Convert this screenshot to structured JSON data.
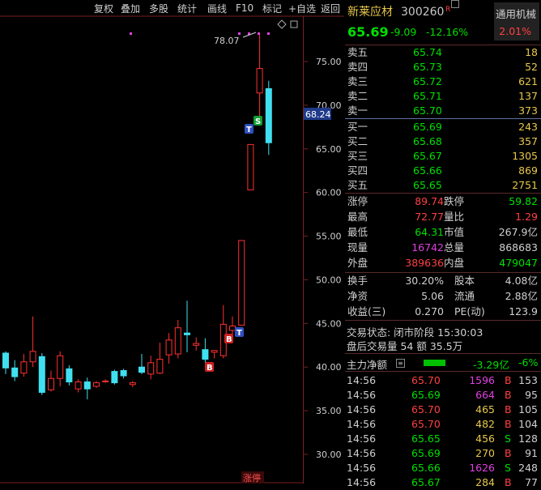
{
  "toolbar": {
    "items": [
      "复权",
      "叠加",
      "多股",
      "统计",
      "画线",
      "F10",
      "标记",
      "+自选",
      "返回"
    ]
  },
  "chart": {
    "y_ticks": [
      "75.00",
      "70.00",
      "65.00",
      "60.00",
      "55.00",
      "50.00",
      "45.00",
      "40.00",
      "35.00",
      "30.00"
    ],
    "current_price_tag": "68.24",
    "high_annotation": "78.07",
    "bottom_label": "涨停",
    "marker_b": "B",
    "marker_s": "S",
    "marker_t": "T"
  },
  "chart_data": {
    "type": "candlestick",
    "y_range": [
      27.5,
      80.0
    ],
    "candles": [
      {
        "o": 41.6,
        "c": 39.9,
        "h": 41.8,
        "l": 39.2
      },
      {
        "o": 39.9,
        "c": 38.9,
        "h": 40.8,
        "l": 38.4
      },
      {
        "o": 39.3,
        "c": 40.6,
        "h": 41.5,
        "l": 38.9
      },
      {
        "o": 40.6,
        "c": 41.8,
        "h": 45.8,
        "l": 40.0
      },
      {
        "o": 41.2,
        "c": 37.1,
        "h": 41.6,
        "l": 36.8
      },
      {
        "o": 37.4,
        "c": 38.7,
        "h": 39.6,
        "l": 37.2
      },
      {
        "o": 38.7,
        "c": 41.3,
        "h": 41.8,
        "l": 37.8
      },
      {
        "o": 39.8,
        "c": 38.3,
        "h": 40.2,
        "l": 37.9
      },
      {
        "o": 37.5,
        "c": 38.3,
        "h": 38.6,
        "l": 37.1
      },
      {
        "o": 38.3,
        "c": 37.5,
        "h": 38.8,
        "l": 36.3
      },
      {
        "o": 37.8,
        "c": 38.2,
        "h": 38.4,
        "l": 37.6
      },
      {
        "o": 38.4,
        "c": 38.4,
        "h": 38.6,
        "l": 38.2
      },
      {
        "o": 39.5,
        "c": 38.2,
        "h": 39.7,
        "l": 38.0
      },
      {
        "o": 39.6,
        "c": 39.0,
        "h": 39.8,
        "l": 38.7
      },
      {
        "o": 38.0,
        "c": 38.2,
        "h": 38.4,
        "l": 37.7
      },
      {
        "o": 40.0,
        "c": 39.4,
        "h": 41.5,
        "l": 39.2
      },
      {
        "o": 39.2,
        "c": 40.5,
        "h": 41.3,
        "l": 38.6
      },
      {
        "o": 39.3,
        "c": 40.9,
        "h": 42.8,
        "l": 39.2
      },
      {
        "o": 41.4,
        "c": 43.1,
        "h": 43.9,
        "l": 40.4
      },
      {
        "o": 41.5,
        "c": 44.5,
        "h": 45.4,
        "l": 41.0
      },
      {
        "o": 43.9,
        "c": 43.7,
        "h": 47.6,
        "l": 41.7
      },
      {
        "o": 42.5,
        "c": 42.7,
        "h": 43.4,
        "l": 41.9
      },
      {
        "o": 42.0,
        "c": 40.9,
        "h": 43.3,
        "l": 40.5
      },
      {
        "o": 41.7,
        "c": 41.9,
        "h": 41.9,
        "l": 41.0
      },
      {
        "o": 41.3,
        "c": 44.9,
        "h": 47.1,
        "l": 41.0
      },
      {
        "o": 44.2,
        "c": 44.7,
        "h": 45.8,
        "l": 43.7
      },
      {
        "o": 44.8,
        "c": 54.5,
        "h": 54.5,
        "l": 44.8
      },
      {
        "o": 60.3,
        "c": 65.5,
        "h": 65.5,
        "l": 60.3
      },
      {
        "o": 71.4,
        "c": 74.2,
        "h": 78.1,
        "l": 68.5
      },
      {
        "o": 71.9,
        "c": 65.7,
        "h": 72.8,
        "l": 64.3
      }
    ]
  },
  "stock": {
    "name": "新莱应材",
    "code": "300260",
    "flag": "R",
    "price": "65.69",
    "change": "-9.09",
    "pct": "-12.16%",
    "sector": "通用机械",
    "sector_pct": "2.01%"
  },
  "ask": [
    {
      "label": "卖五",
      "price": "65.74",
      "vol": "18"
    },
    {
      "label": "卖四",
      "price": "65.73",
      "vol": "52"
    },
    {
      "label": "卖三",
      "price": "65.72",
      "vol": "621"
    },
    {
      "label": "卖二",
      "price": "65.71",
      "vol": "137"
    },
    {
      "label": "卖一",
      "price": "65.70",
      "vol": "373"
    }
  ],
  "bid": [
    {
      "label": "买一",
      "price": "65.69",
      "vol": "243"
    },
    {
      "label": "买二",
      "price": "65.68",
      "vol": "357"
    },
    {
      "label": "买三",
      "price": "65.67",
      "vol": "1305"
    },
    {
      "label": "买四",
      "price": "65.66",
      "vol": "869"
    },
    {
      "label": "买五",
      "price": "65.65",
      "vol": "2751"
    }
  ],
  "stats": [
    {
      "l1": "涨停",
      "v1": "89.74",
      "l2": "跌停",
      "v2": "59.82",
      "c1": "#ff4040",
      "c2": "#00e000"
    },
    {
      "l1": "最高",
      "v1": "72.77",
      "l2": "量比",
      "v2": "1.29",
      "c1": "#ff4040",
      "c2": "#ff4040"
    },
    {
      "l1": "最低",
      "v1": "64.31",
      "l2": "市值",
      "v2": "267.9亿",
      "c1": "#00e000",
      "c2": "#d0d0d0"
    },
    {
      "l1": "现量",
      "v1": "16742",
      "l2": "总量",
      "v2": "868683",
      "c1": "#e040e0",
      "c2": "#d0d0d0"
    },
    {
      "l1": "外盘",
      "v1": "389636",
      "l2": "内盘",
      "v2": "479047",
      "c1": "#ff4040",
      "c2": "#00e000"
    }
  ],
  "stats2": [
    {
      "l1": "换手",
      "v1": "30.20%",
      "l2": "股本",
      "v2": "4.08亿"
    },
    {
      "l1": "净资",
      "v1": "5.06",
      "l2": "流通",
      "v2": "2.88亿"
    },
    {
      "l1": "收益(三)",
      "v1": "0.270",
      "l2": "PE(动)",
      "v2": "123.9"
    }
  ],
  "trade_status": "交易状态: 闭市阶段 15:30:03",
  "after_hours": "盘后交易量 54 额 35.5万",
  "main_flow": {
    "label": "主力净额",
    "value": "-3.29亿",
    "pct": "-6%"
  },
  "ticks": [
    {
      "t": "14:56",
      "p": "65.70",
      "v": "1596",
      "s": "B",
      "n": "153",
      "pc": "#ff4040",
      "vc": "#e040e0"
    },
    {
      "t": "14:56",
      "p": "65.69",
      "v": "664",
      "s": "B",
      "n": "95",
      "pc": "#00e000",
      "vc": "#e040e0"
    },
    {
      "t": "14:56",
      "p": "65.70",
      "v": "465",
      "s": "B",
      "n": "105",
      "pc": "#ff4040",
      "vc": "#e8c84a"
    },
    {
      "t": "14:56",
      "p": "65.70",
      "v": "482",
      "s": "B",
      "n": "104",
      "pc": "#ff4040",
      "vc": "#e8c84a"
    },
    {
      "t": "14:56",
      "p": "65.65",
      "v": "456",
      "s": "S",
      "n": "128",
      "pc": "#00e000",
      "vc": "#e8c84a"
    },
    {
      "t": "14:56",
      "p": "65.69",
      "v": "270",
      "s": "B",
      "n": "91",
      "pc": "#00e000",
      "vc": "#e8c84a"
    },
    {
      "t": "14:56",
      "p": "65.66",
      "v": "1626",
      "s": "S",
      "n": "248",
      "pc": "#00e000",
      "vc": "#e040e0"
    },
    {
      "t": "14:56",
      "p": "65.67",
      "v": "284",
      "s": "B",
      "n": "77",
      "pc": "#00e000",
      "vc": "#e8c84a"
    }
  ]
}
